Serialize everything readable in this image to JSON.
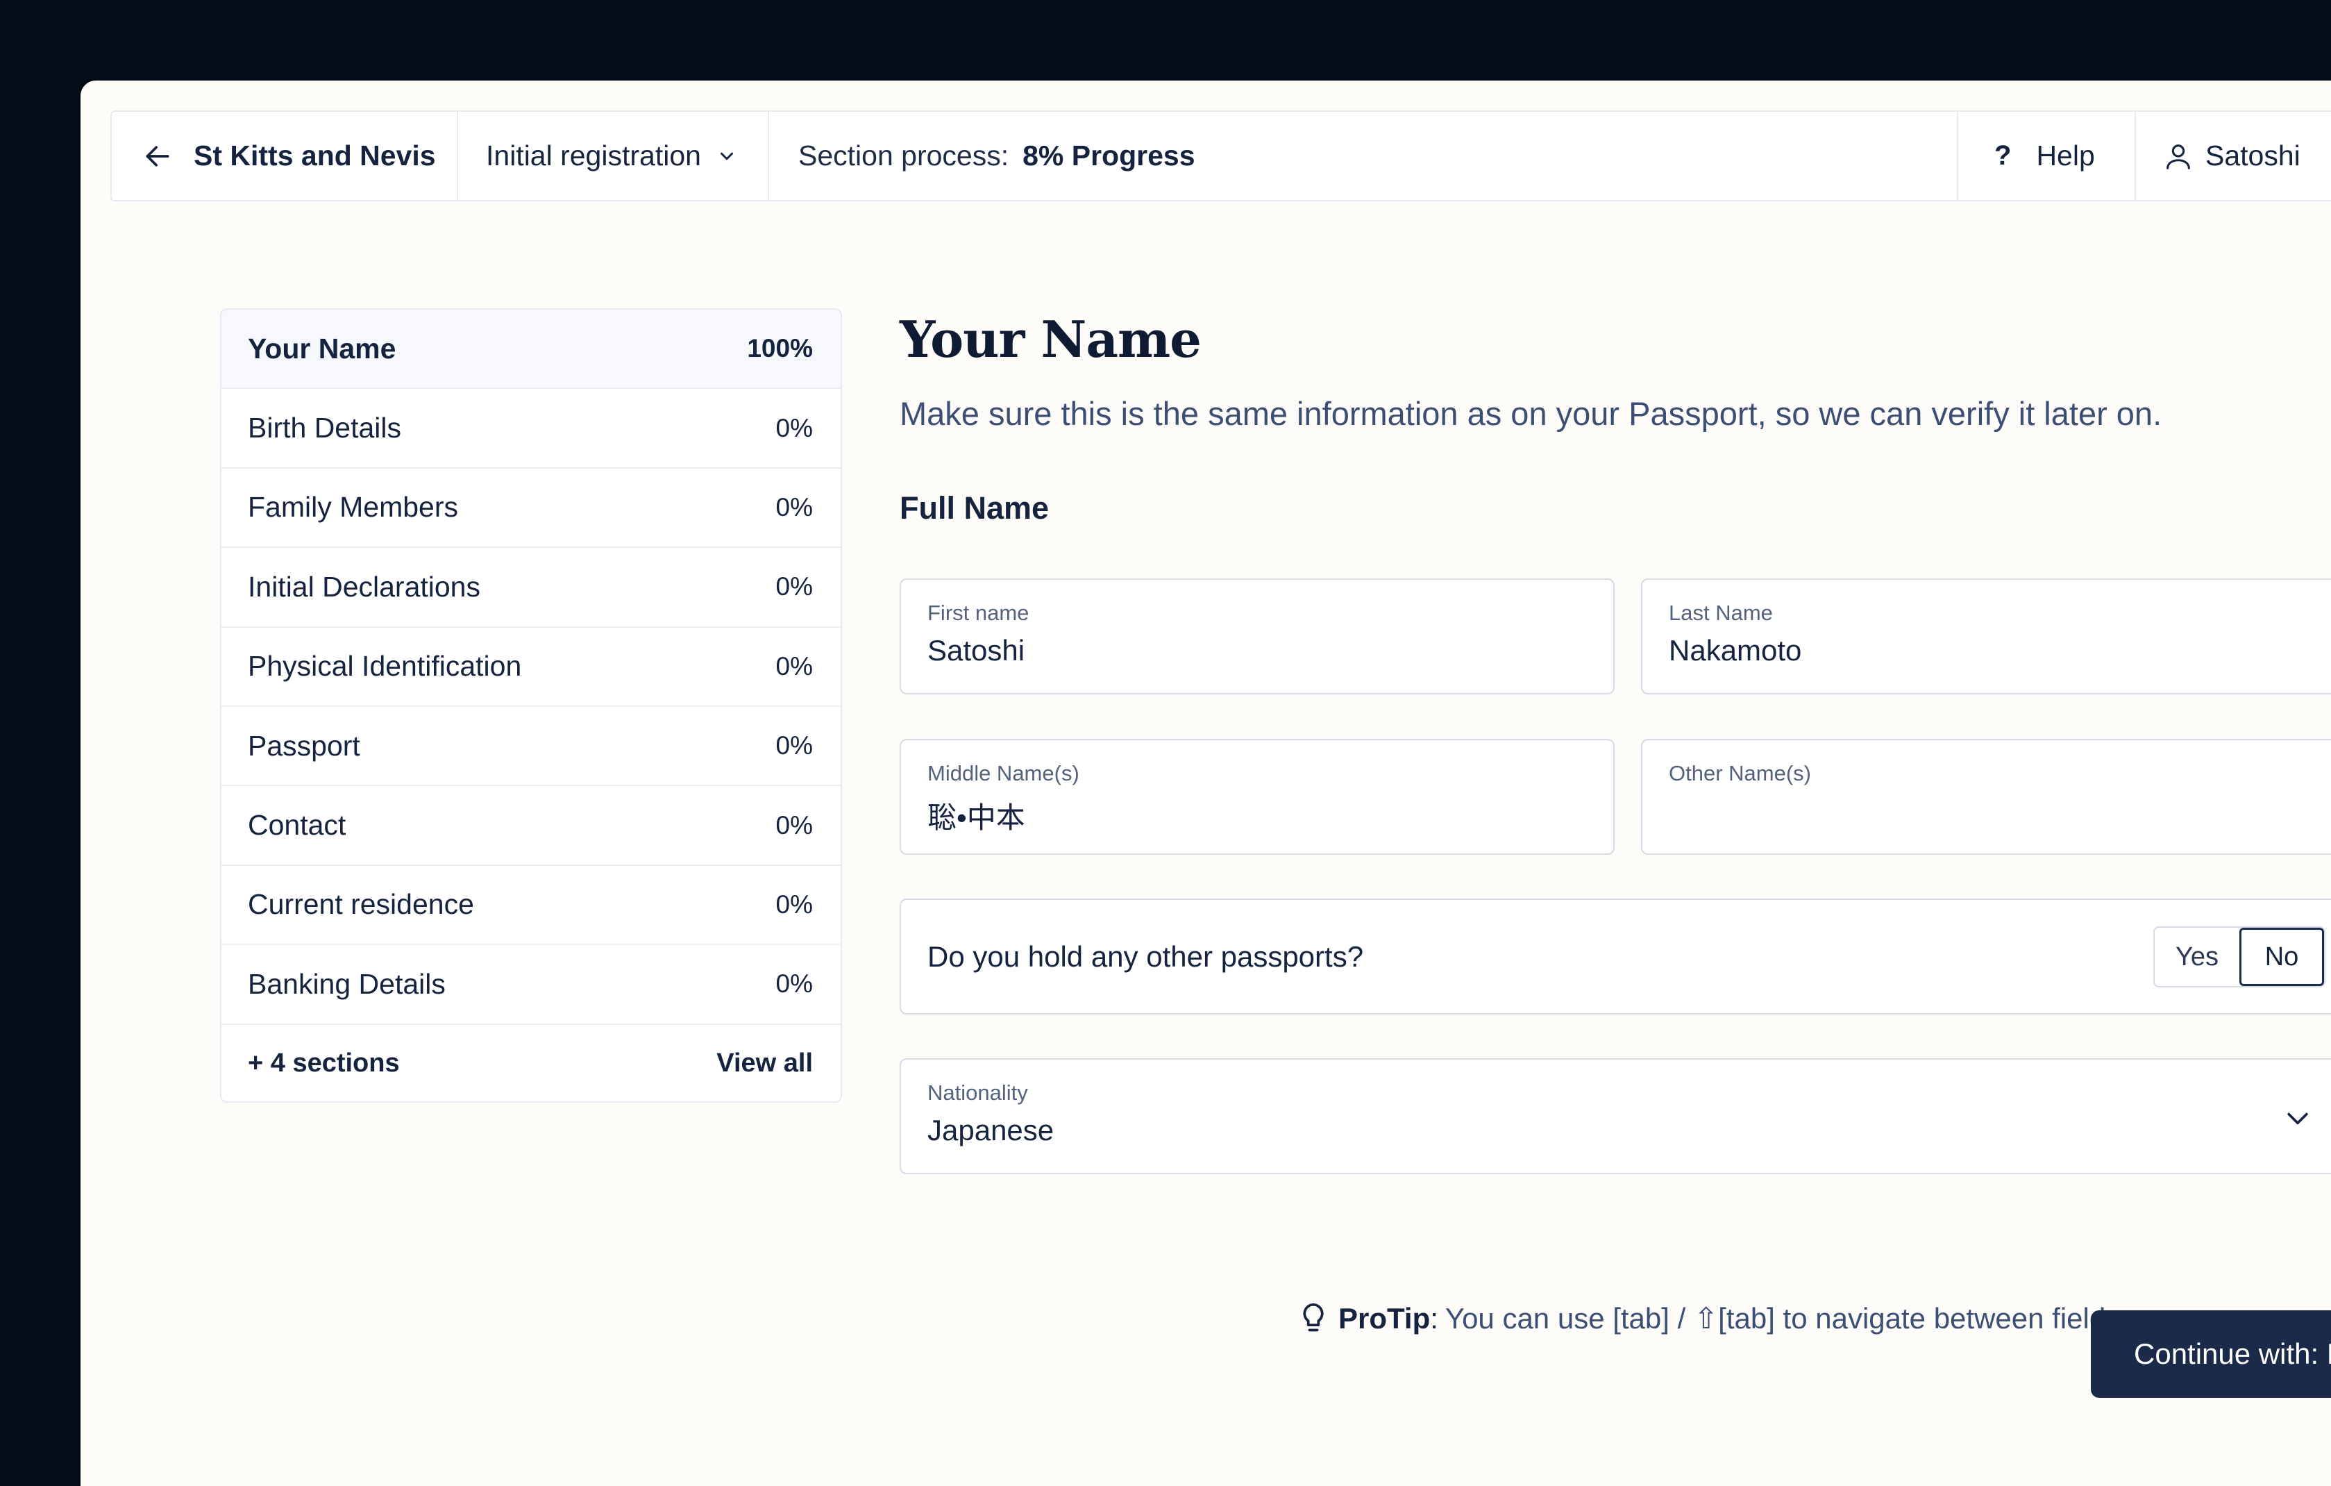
{
  "topbar": {
    "back_label": "St Kitts and Nevis",
    "registration_label": "Initial registration",
    "progress_prefix": "Section process:",
    "progress_value": "8% Progress",
    "help_glyph": "?",
    "help_label": "Help",
    "user_label": "Satoshi"
  },
  "sidebar": {
    "items": [
      {
        "label": "Your Name",
        "pct": "100%"
      },
      {
        "label": "Birth Details",
        "pct": "0%"
      },
      {
        "label": "Family Members",
        "pct": "0%"
      },
      {
        "label": "Initial Declarations",
        "pct": "0%"
      },
      {
        "label": "Physical Identification",
        "pct": "0%"
      },
      {
        "label": "Passport",
        "pct": "0%"
      },
      {
        "label": "Contact",
        "pct": "0%"
      },
      {
        "label": "Current residence",
        "pct": "0%"
      },
      {
        "label": "Banking Details",
        "pct": "0%"
      }
    ],
    "more_label": "+ 4 sections",
    "view_all_label": "View all"
  },
  "main": {
    "title": "Your Name",
    "subtitle": "Make sure this is the same information as on your Passport, so we can verify it later on.",
    "section_label": "Full Name",
    "fields": {
      "first_name": {
        "label": "First name",
        "value": "Satoshi"
      },
      "last_name": {
        "label": "Last Name",
        "value": "Nakamoto"
      },
      "middle_names": {
        "label": "Middle Name(s)",
        "value": "聡•中本"
      },
      "other_names": {
        "label": "Other Name(s)",
        "value": ""
      }
    },
    "passport_question": "Do you hold any other passports?",
    "yes_label": "Yes",
    "no_label": "No",
    "selected_answer": "No",
    "nationality": {
      "label": "Nationality",
      "value": "Japanese"
    },
    "protip": {
      "label": "ProTip",
      "colon": ":",
      "text": "You can use [tab] / ⇧[tab] to navigate between fields"
    },
    "continue_label": "Continue with: Birth Details"
  },
  "icons": {
    "back": "arrow-left-icon",
    "dropdown": "chevron-down-icon",
    "user": "user-icon",
    "tip": "lightbulb-icon"
  },
  "colors": {
    "primary": "#1b2a48",
    "background": "#fdfcf9",
    "frame": "#050b17"
  }
}
